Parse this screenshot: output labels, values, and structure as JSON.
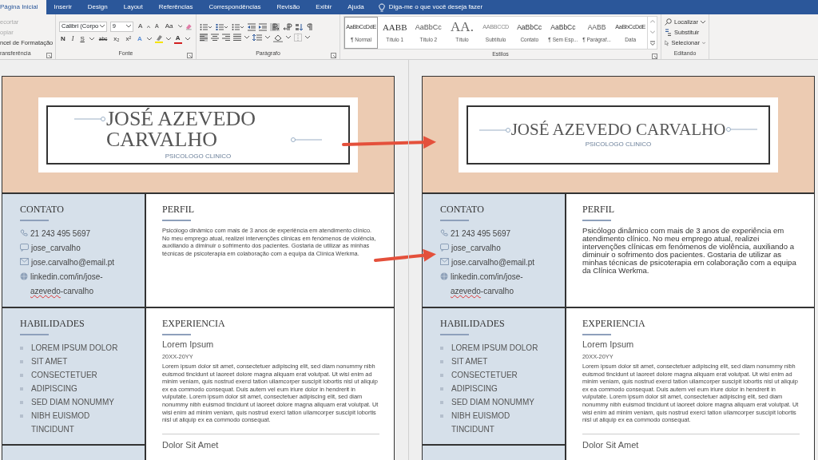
{
  "ribbon": {
    "tabs": [
      {
        "label": "Página Inicial",
        "selected": true
      },
      {
        "label": "Inserir",
        "selected": false
      },
      {
        "label": "Design",
        "selected": false
      },
      {
        "label": "Layout",
        "selected": false
      },
      {
        "label": "Referências",
        "selected": false
      },
      {
        "label": "Correspondências",
        "selected": false
      },
      {
        "label": "Revisão",
        "selected": false
      },
      {
        "label": "Exibir",
        "selected": false
      },
      {
        "label": "Ajuda",
        "selected": false
      }
    ],
    "tell_me": "Diga-me o que você deseja fazer",
    "clipboard": {
      "items": [
        {
          "label": "ecortar",
          "disabled": true
        },
        {
          "label": "opiar",
          "disabled": true
        },
        {
          "label": "ncel de Formatação",
          "disabled": false
        }
      ],
      "label": "ransferência"
    },
    "font": {
      "font_name": "Calibri (Corpo",
      "font_size": "9",
      "grow": "A",
      "shrink": "A",
      "case": "Aa",
      "format_buttons": [
        {
          "kind": "bold",
          "label": "N"
        },
        {
          "kind": "italic",
          "label": "I"
        },
        {
          "kind": "underline",
          "label": "S"
        },
        {
          "kind": "strike",
          "label": "abc"
        },
        {
          "kind": "sub",
          "label": "x₂"
        },
        {
          "kind": "sup",
          "label": "x²"
        }
      ],
      "effects": "A",
      "text_color_button": "A",
      "label": "Fonte"
    },
    "paragraph": {
      "direction_buttons": [
        {
          "kind": "ltr",
          "selected": true
        },
        {
          "kind": "rtl",
          "selected": false
        }
      ],
      "alignment_buttons": [
        {
          "kind": "left",
          "selected": true
        },
        {
          "kind": "center",
          "selected": false
        },
        {
          "kind": "right",
          "selected": false
        },
        {
          "kind": "justify",
          "selected": false
        }
      ],
      "label": "Parágrafo"
    },
    "styles": {
      "items": [
        {
          "kind": "normal",
          "sample": "AaBbCcDdE",
          "name": "¶ Normal",
          "selected": true
        },
        {
          "kind": "title1",
          "sample": "AABB",
          "name": "Título 1",
          "selected": false
        },
        {
          "kind": "title2",
          "sample": "AaBbCc",
          "name": "Título 2",
          "selected": false
        },
        {
          "kind": "title",
          "sample": "AA.",
          "name": "Título",
          "selected": false
        },
        {
          "kind": "subtitle",
          "sample": "AABBCCD",
          "name": "Subtítulo",
          "selected": false
        },
        {
          "kind": "contact",
          "sample": "AaBbCc",
          "name": "Contato",
          "selected": false
        },
        {
          "kind": "contact",
          "sample": "AaBbCc",
          "name": "¶ Sem Esp...",
          "selected": false
        },
        {
          "kind": "paragraph",
          "sample": "AABB",
          "name": "¶ Parágraf...",
          "selected": false
        },
        {
          "kind": "normal",
          "sample": "AaBbCcDdE",
          "name": "Data",
          "selected": false
        }
      ],
      "label": "Estilos"
    },
    "editing": {
      "items": [
        {
          "kind": "find",
          "label": "Localizar",
          "dropdown": true
        },
        {
          "kind": "replace",
          "label": "Substituir",
          "dropdown": false
        },
        {
          "kind": "select",
          "label": "Selecionar",
          "dropdown": true
        }
      ],
      "label": "Editando"
    }
  },
  "pages": [
    {
      "kind": "original",
      "header": {
        "name": "JOSÉ AZEVEDO CARVALHO",
        "title": "PSICOLOGO CLINICO"
      },
      "contact": {
        "heading": "CONTATO",
        "items": [
          {
            "kind": "phone",
            "segments": [
              {
                "text": "21 243 495 5697",
                "misspelled": false
              }
            ]
          },
          {
            "kind": "chat",
            "segments": [
              {
                "text": "jose_carvalho",
                "misspelled": false
              }
            ]
          },
          {
            "kind": "email",
            "segments": [
              {
                "text": "jose.carvalho@email.pt",
                "misspelled": false
              }
            ]
          },
          {
            "kind": "web",
            "segments": [
              {
                "text": "linkedin.com/in/jose-",
                "misspelled": false
              },
              {
                "text": "azevedo",
                "misspelled": true
              },
              {
                "text": "-carvalho",
                "misspelled": false
              }
            ]
          }
        ]
      },
      "profile": {
        "heading": "PERFIL",
        "text": "Psicólogo dinâmico com mais de 3 anos de experiência em atendimento clínico. No meu emprego atual, realizei intervenções clínicas em fenómenos de violência, auxiliando a diminuir o sofrimento dos pacientes. Gostaria de utilizar as minhas técnicas de psicoterapia em colaboração com a equipa da Clínica Werkma."
      },
      "skills": {
        "heading": "HABILIDADES",
        "items": [
          "LOREM IPSUM DOLOR",
          "SIT AMET",
          "CONSECTETUER",
          "ADIPISCING",
          "SED DIAM NONUMMY",
          "NIBH EUISMOD TINCIDUNT"
        ]
      },
      "experience": {
        "heading": "EXPERIENCIA",
        "jobs": [
          {
            "title": "Lorem Ipsum",
            "dates": "20XX-20YY",
            "description": "Lorem ipsum dolor sit amet, consectetuer adipiscing elit, sed diam nonummy nibh euismod tincidunt ut laoreet dolore magna aliquam erat volutpat. Ut wisi enim ad minim veniam, quis nostrud exerci tation ullamcorper suscipit lobortis nisl ut aliquip ex ea commodo consequat. Duis autem vel eum iriure dolor in hendrerit in vulputate. Lorem ipsum dolor sit amet, consectetuer adipiscing elit, sed diam nonummy nibh euismod tincidunt ut laoreet dolore magna aliquam erat volutpat. Ut wisi enim ad minim veniam, quis nostrud exerci tation ullamcorper suscipit lobortis nisl ut aliquip ex ea commodo consequat."
          },
          {
            "title": "Dolor Sit Amet"
          }
        ]
      }
    },
    {
      "kind": "adjusted",
      "header": {
        "name": "JOSÉ AZEVEDO CARVALHO",
        "title": "PSICOLOGO CLINICO"
      },
      "contact": {
        "heading": "CONTATO",
        "items": [
          {
            "kind": "phone",
            "segments": [
              {
                "text": "21 243 495 5697",
                "misspelled": false
              }
            ]
          },
          {
            "kind": "chat",
            "segments": [
              {
                "text": "jose_carvalho",
                "misspelled": false
              }
            ]
          },
          {
            "kind": "email",
            "segments": [
              {
                "text": "jose.carvalho@email.pt",
                "misspelled": false
              }
            ]
          },
          {
            "kind": "web",
            "segments": [
              {
                "text": "linkedin.com/in/jose-",
                "misspelled": false
              },
              {
                "text": "azevedo",
                "misspelled": true
              },
              {
                "text": "-carvalho",
                "misspelled": false
              }
            ]
          }
        ]
      },
      "profile": {
        "heading": "PERFIL",
        "text": "Psicólogo dinâmico com mais de 3 anos de experiência em atendimento clínico. No meu emprego atual, realizei intervenções clínicas em fenómenos de violência, auxiliando a diminuir o sofrimento dos pacientes. Gostaria de utilizar as minhas técnicas de psicoterapia em colaboração com a equipa da Clínica Werkma."
      },
      "skills": {
        "heading": "HABILIDADES",
        "items": [
          "LOREM IPSUM DOLOR",
          "SIT AMET",
          "CONSECTETUER",
          "ADIPISCING",
          "SED DIAM NONUMMY",
          "NIBH EUISMOD TINCIDUNT"
        ]
      },
      "experience": {
        "heading": "EXPERIENCIA",
        "jobs": [
          {
            "title": "Lorem Ipsum",
            "dates": "20XX-20YY",
            "description": "Lorem ipsum dolor sit amet, consectetuer adipiscing elit, sed diam nonummy nibh euismod tincidunt ut laoreet dolore magna aliquam erat volutpat. Ut wisi enim ad minim veniam, quis nostrud exerci tation ullamcorper suscipit lobortis nisl ut aliquip ex ea commodo consequat. Duis autem vel eum iriure dolor in hendrerit in vulputate. Lorem ipsum dolor sit amet, consectetuer adipiscing elit, sed diam nonummy nibh euismod tincidunt ut laoreet dolore magna aliquam erat volutpat. Ut wisi enim ad minim veniam, quis nostrud exerci tation ullamcorper suscipit lobortis nisl ut aliquip ex ea commodo consequat."
          },
          {
            "title": "Dolor Sit Amet"
          }
        ]
      }
    }
  ]
}
